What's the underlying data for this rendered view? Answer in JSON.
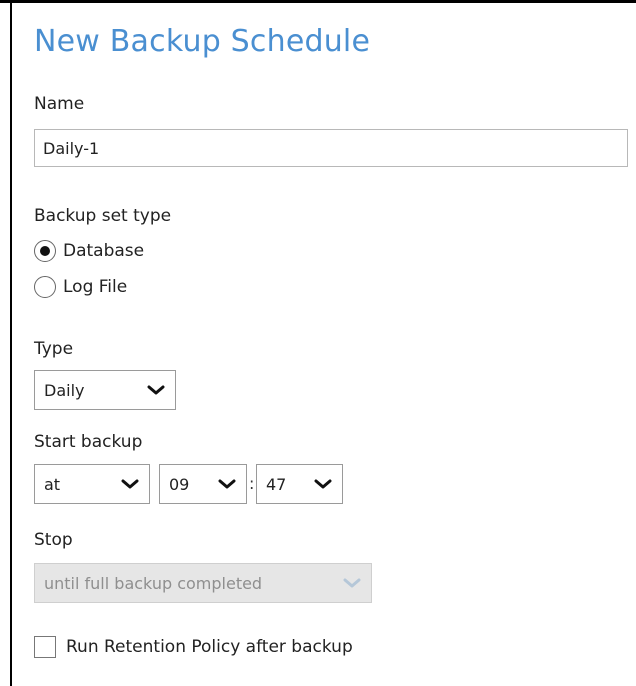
{
  "dialog": {
    "title": "New Backup Schedule"
  },
  "name_field": {
    "label": "Name",
    "value": "Daily-1"
  },
  "backup_set_type": {
    "label": "Backup set type",
    "options": [
      {
        "label": "Database",
        "selected": true
      },
      {
        "label": "Log File",
        "selected": false
      }
    ]
  },
  "type_field": {
    "label": "Type",
    "value": "Daily"
  },
  "start_backup": {
    "label": "Start backup",
    "mode": "at",
    "hour": "09",
    "separator": ":",
    "minute": "47"
  },
  "stop": {
    "label": "Stop",
    "value": "until full backup completed",
    "disabled": true
  },
  "retention": {
    "label": "Run Retention Policy after backup",
    "checked": false
  },
  "icons": {
    "dropdown": "chevron-down-icon",
    "radio": "radio-icon",
    "checkbox": "checkbox-icon"
  },
  "colors": {
    "title": "#4a8fd1",
    "disabled_bg": "#e6e6e6",
    "border": "#9a9a9a"
  }
}
